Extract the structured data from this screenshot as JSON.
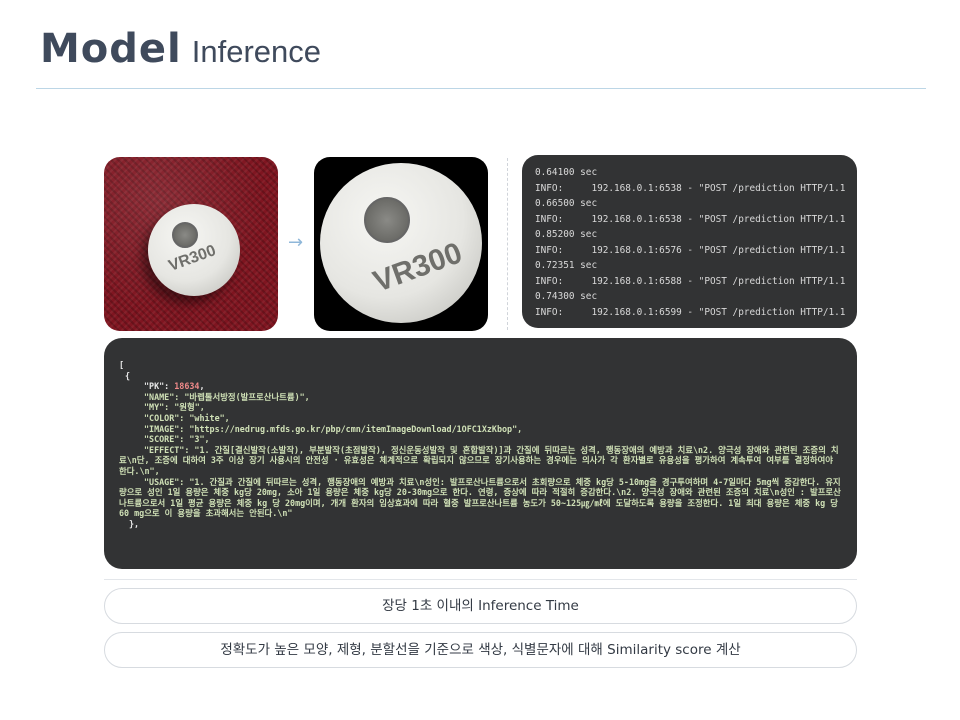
{
  "slide": {
    "title_bold": "Model",
    "title_light": "Inference"
  },
  "images": {
    "original_photo_text": "VR300",
    "processed_photo_text": "VR300",
    "arrow": "→"
  },
  "log_lines": [
    "0.64100 sec",
    "INFO:     192.168.0.1:6538 - \"POST /prediction HTTP/1.1",
    "0.66500 sec",
    "INFO:     192.168.0.1:6538 - \"POST /prediction HTTP/1.1",
    "0.85200 sec",
    "INFO:     192.168.0.1:6576 - \"POST /prediction HTTP/1.1",
    "0.72351 sec",
    "INFO:     192.168.0.1:6588 - \"POST /prediction HTTP/1.1",
    "0.74300 sec",
    "INFO:     192.168.0.1:6599 - \"POST /prediction HTTP/1.1"
  ],
  "json_output": {
    "open_bracket": "[",
    "open_brace": "{",
    "pk_key": "\"PK\": ",
    "pk_value": "18634",
    "name_line": "\"NAME\": \"바렙톨서방정(발프로산나트륨)\",",
    "my_line": "\"MY\": \"원형\",",
    "color_line": "\"COLOR\": \"white\",",
    "image_line": "\"IMAGE\": \"https://nedrug.mfds.go.kr/pbp/cmn/itemImageDownload/1OFC1XzKbop\",",
    "score_line": "\"SCORE\": \"3\",",
    "effect_text": "\"EFFECT\": \"1. 간질[결신발작(소발작), 부분발작(초점발작), 정신운동성발작 및 혼합발작)]과 간질에 뒤따르는 성격, 행동장애의 예방과 치료\\n2. 양극성 장애와 관련된 조증의 치료\\n단, 조증에 대하여 3주 이상 장기 사용시의 안전성 · 유효성은 체계적으로 확립되지 않으므로 장기사용하는 경우에는 의사가 각 환자별로 유용성을 평가하여 계속투여 여부를 결정하여야 한다.\\n\",",
    "usage_text": "\"USAGE\": \"1. 간질과 간질에 뒤따르는 성격, 행동장애의 예방과 치료\\n성인: 발프로산나트륨으로서 초회량으로 체중 kg당 5-10mg을 경구투여하며 4-7일마다 5mg씩 증감한다. 유지량으로 성인 1일 용량은 체중 kg당 20mg, 소아 1일 용량은 체중 kg당 20-30mg으로 한다. 연령, 증상에 따라 적절히 증감한다.\\n2. 양극성 장애와 관련된 조증의 치료\\n성인 : 발프로산나트륨으로서 1일 평균 용량은 체중 kg 당 20mg이며, 개개 환자의 임상효과에 따라 혈중 발프로산나트륨 농도가 50~125㎍/㎖에 도달하도록 용량을 조정한다. 1일 최대 용량은 체중 kg 당 60 mg으로 이 용량을 초과해서는 안된다.\\n\"",
    "close_brace": "},"
  },
  "captions": {
    "first": "장당 1초 이내의 Inference Time",
    "second": "정확도가 높은 모양, 제형, 분할선을 기준으로 색상, 식별문자에 대해 Similarity score 계산"
  }
}
